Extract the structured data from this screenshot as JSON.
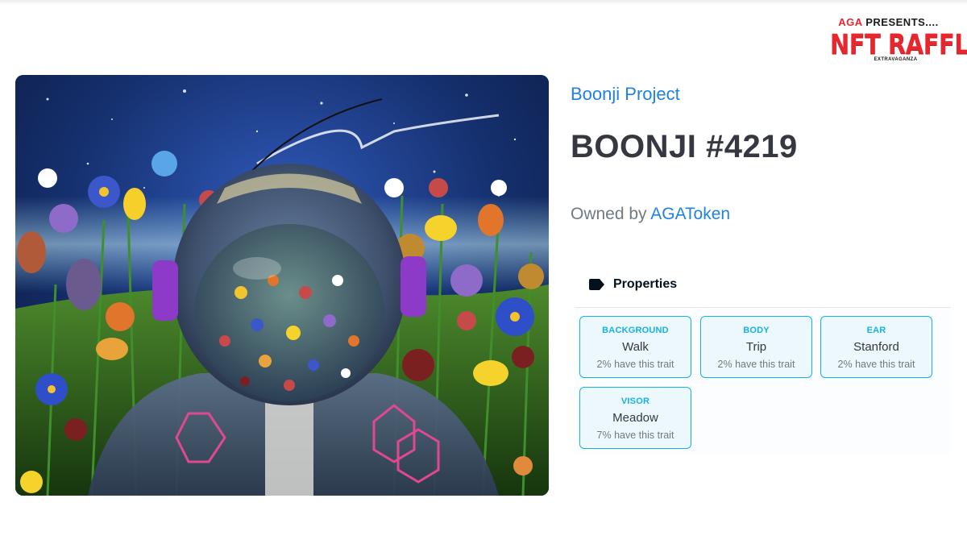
{
  "branding": {
    "presents_accent": "AGA",
    "presents_rest": " PRESENTS....",
    "title": "NFT RAFFLE",
    "subtitle": "EXTRAVAGANZA",
    "accent_color": "#e8262d"
  },
  "artwork": {
    "icon": "astronaut-flower-artwork"
  },
  "nft": {
    "collection": "Boonji Project",
    "title": "BOONJI #4219",
    "owned_by_label": "Owned by ",
    "owner": "AGAToken"
  },
  "properties": {
    "label": "Properties",
    "icon": "tag-icon",
    "traits": [
      {
        "type": "BACKGROUND",
        "value": "Walk",
        "rarity": "2% have this trait"
      },
      {
        "type": "BODY",
        "value": "Trip",
        "rarity": "2% have this trait"
      },
      {
        "type": "EAR",
        "value": "Stanford",
        "rarity": "2% have this trait"
      },
      {
        "type": "VISOR",
        "value": "Meadow",
        "rarity": "7% have this trait"
      }
    ]
  },
  "colors": {
    "link": "#2081e2",
    "title": "#353840",
    "muted": "#707a83",
    "trait_accent": "#15b2e5"
  }
}
